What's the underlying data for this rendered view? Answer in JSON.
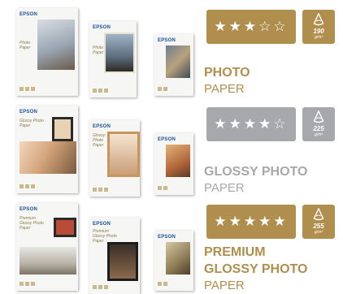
{
  "products": [
    {
      "rating_stars": "★★★☆☆",
      "rating_value": 3,
      "rating_max": 5,
      "weight_value": "190",
      "weight_unit": "g/m²",
      "title_line1": "PHOTO",
      "title_line2": "",
      "subtitle": "PAPER",
      "color": "#b08f4e",
      "packs": [
        {
          "brand": "EPSON",
          "tag": "Photo Paper"
        },
        {
          "brand": "EPSON",
          "tag": "Photo Paper"
        },
        {
          "brand": "EPSON",
          "tag": ""
        }
      ]
    },
    {
      "rating_stars": "★★★★☆",
      "rating_value": 4,
      "rating_max": 5,
      "weight_value": "225",
      "weight_unit": "g/m²",
      "title_line1": "GLOSSY PHOTO",
      "title_line2": "",
      "subtitle": "PAPER",
      "color": "#a6a8ab",
      "packs": [
        {
          "brand": "EPSON",
          "tag": "Glossy Photo Paper"
        },
        {
          "brand": "EPSON",
          "tag": "Glossy Photo Paper"
        },
        {
          "brand": "EPSON",
          "tag": ""
        }
      ]
    },
    {
      "rating_stars": "★★★★★",
      "rating_value": 5,
      "rating_max": 5,
      "weight_value": "255",
      "weight_unit": "g/m²",
      "title_line1": "PREMIUM",
      "title_line2": "GLOSSY PHOTO",
      "subtitle": "PAPER",
      "color": "#b08f4e",
      "packs": [
        {
          "brand": "EPSON",
          "tag": "Premium Glossy Photo Paper"
        },
        {
          "brand": "EPSON",
          "tag": "Premium Glossy Photo Paper"
        },
        {
          "brand": "EPSON",
          "tag": ""
        }
      ]
    }
  ]
}
